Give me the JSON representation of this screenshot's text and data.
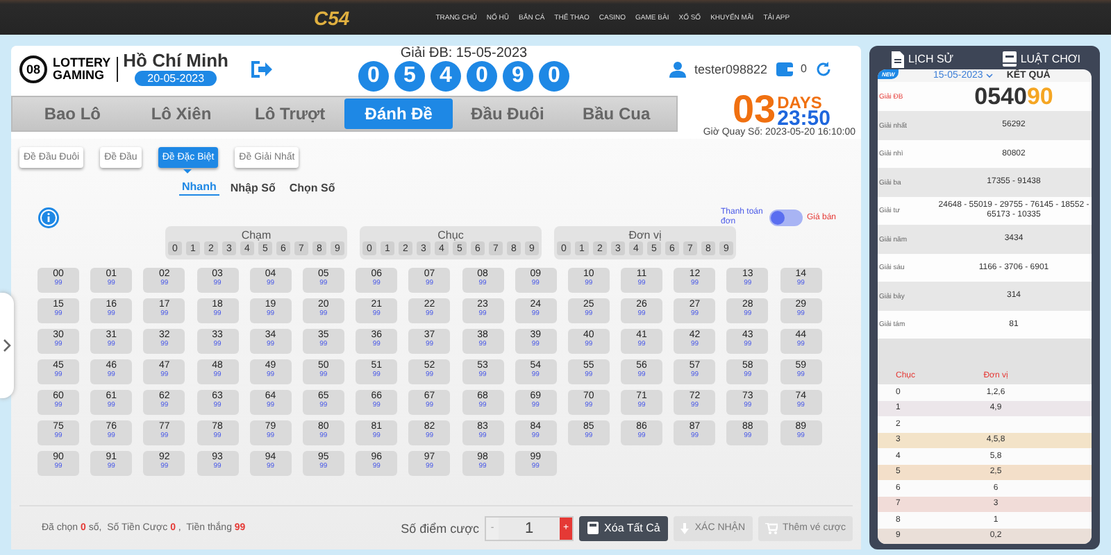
{
  "top_nav": {
    "logo": "C54",
    "items": [
      "TRANG CHỦ",
      "NỔ HŨ",
      "BẮN CÁ",
      "THỂ THAO",
      "CASINO",
      "GAME BÀI",
      "XỔ SỐ",
      "KHUYẾN MÃI",
      "TẢI APP"
    ]
  },
  "header": {
    "brand_badge": "08",
    "brand_line1": "LOTTERY",
    "brand_line2": "GAMING",
    "region": "Hồ Chí Minh",
    "date": "20-05-2023",
    "result_title": "Giải ĐB: 15-05-2023",
    "result_digits": [
      "0",
      "5",
      "4",
      "0",
      "9",
      "0"
    ],
    "username": "tester098822",
    "balance": "0"
  },
  "game_tabs": [
    {
      "label": "Bao Lô",
      "selected": false
    },
    {
      "label": "Lô Xiên",
      "selected": false
    },
    {
      "label": "Lô Trượt",
      "selected": false
    },
    {
      "label": "Đánh Đề",
      "selected": true
    },
    {
      "label": "Đầu Đuôi",
      "selected": false
    },
    {
      "label": "Bầu Cua",
      "selected": false
    }
  ],
  "countdown": {
    "days": "03",
    "days_label": "DAYS",
    "time": "23:50",
    "draw_time": "Giờ Quay Số: 2023-05-20 16:10:00"
  },
  "bet_types": [
    {
      "label": "Đề Đầu Đuôi",
      "selected": false
    },
    {
      "label": "Đề Đầu",
      "selected": false
    },
    {
      "label": "Đề Đặc Biệt",
      "selected": true
    },
    {
      "label": "Đề Giải Nhất",
      "selected": false
    }
  ],
  "modes": [
    {
      "label": "Nhanh",
      "selected": true
    },
    {
      "label": "Nhập Số",
      "selected": false
    },
    {
      "label": "Chọn Số",
      "selected": false
    }
  ],
  "toggle": {
    "left_label": "Thanh toán đơn",
    "right_label": "Giá bán",
    "on": false
  },
  "digit_groups": [
    {
      "title": "Chạm",
      "digits": [
        {
          "d": "0",
          "selected": false
        },
        {
          "d": "1",
          "selected": false
        },
        {
          "d": "2",
          "selected": false
        },
        {
          "d": "3",
          "selected": false
        },
        {
          "d": "4",
          "selected": false
        },
        {
          "d": "5",
          "selected": false
        },
        {
          "d": "6",
          "selected": false
        },
        {
          "d": "7",
          "selected": false
        },
        {
          "d": "8",
          "selected": false
        },
        {
          "d": "9",
          "selected": false
        }
      ]
    },
    {
      "title": "Chục",
      "digits": [
        {
          "d": "0",
          "selected": false
        },
        {
          "d": "1",
          "selected": false
        },
        {
          "d": "2",
          "selected": false
        },
        {
          "d": "3",
          "selected": false
        },
        {
          "d": "4",
          "selected": false
        },
        {
          "d": "5",
          "selected": false
        },
        {
          "d": "6",
          "selected": false
        },
        {
          "d": "7",
          "selected": false
        },
        {
          "d": "8",
          "selected": false
        },
        {
          "d": "9",
          "selected": false
        }
      ]
    },
    {
      "title": "Đơn vị",
      "digits": [
        {
          "d": "0",
          "selected": false
        },
        {
          "d": "1",
          "selected": false
        },
        {
          "d": "2",
          "selected": false
        },
        {
          "d": "3",
          "selected": false
        },
        {
          "d": "4",
          "selected": false
        },
        {
          "d": "5",
          "selected": false
        },
        {
          "d": "6",
          "selected": false
        },
        {
          "d": "7",
          "selected": false
        },
        {
          "d": "8",
          "selected": false
        },
        {
          "d": "9",
          "selected": false
        }
      ]
    }
  ],
  "numbers": [
    {
      "n": "00",
      "odds": "99",
      "selected": false
    },
    {
      "n": "01",
      "odds": "99",
      "selected": false
    },
    {
      "n": "02",
      "odds": "99",
      "selected": false
    },
    {
      "n": "03",
      "odds": "99",
      "selected": false
    },
    {
      "n": "04",
      "odds": "99",
      "selected": false
    },
    {
      "n": "05",
      "odds": "99",
      "selected": false
    },
    {
      "n": "06",
      "odds": "99",
      "selected": false
    },
    {
      "n": "07",
      "odds": "99",
      "selected": false
    },
    {
      "n": "08",
      "odds": "99",
      "selected": false
    },
    {
      "n": "09",
      "odds": "99",
      "selected": false
    },
    {
      "n": "10",
      "odds": "99",
      "selected": false
    },
    {
      "n": "11",
      "odds": "99",
      "selected": false
    },
    {
      "n": "12",
      "odds": "99",
      "selected": false
    },
    {
      "n": "13",
      "odds": "99",
      "selected": false
    },
    {
      "n": "14",
      "odds": "99",
      "selected": false
    },
    {
      "n": "15",
      "odds": "99",
      "selected": false
    },
    {
      "n": "16",
      "odds": "99",
      "selected": false
    },
    {
      "n": "17",
      "odds": "99",
      "selected": false
    },
    {
      "n": "18",
      "odds": "99",
      "selected": false
    },
    {
      "n": "19",
      "odds": "99",
      "selected": false
    },
    {
      "n": "20",
      "odds": "99",
      "selected": false
    },
    {
      "n": "21",
      "odds": "99",
      "selected": false
    },
    {
      "n": "22",
      "odds": "99",
      "selected": false
    },
    {
      "n": "23",
      "odds": "99",
      "selected": false
    },
    {
      "n": "24",
      "odds": "99",
      "selected": false
    },
    {
      "n": "25",
      "odds": "99",
      "selected": false
    },
    {
      "n": "26",
      "odds": "99",
      "selected": false
    },
    {
      "n": "27",
      "odds": "99",
      "selected": false
    },
    {
      "n": "28",
      "odds": "99",
      "selected": false
    },
    {
      "n": "29",
      "odds": "99",
      "selected": false
    },
    {
      "n": "30",
      "odds": "99",
      "selected": false
    },
    {
      "n": "31",
      "odds": "99",
      "selected": false
    },
    {
      "n": "32",
      "odds": "99",
      "selected": false
    },
    {
      "n": "33",
      "odds": "99",
      "selected": false
    },
    {
      "n": "34",
      "odds": "99",
      "selected": false
    },
    {
      "n": "35",
      "odds": "99",
      "selected": false
    },
    {
      "n": "36",
      "odds": "99",
      "selected": false
    },
    {
      "n": "37",
      "odds": "99",
      "selected": false
    },
    {
      "n": "38",
      "odds": "99",
      "selected": false
    },
    {
      "n": "39",
      "odds": "99",
      "selected": false
    },
    {
      "n": "40",
      "odds": "99",
      "selected": false
    },
    {
      "n": "41",
      "odds": "99",
      "selected": false
    },
    {
      "n": "42",
      "odds": "99",
      "selected": false
    },
    {
      "n": "43",
      "odds": "99",
      "selected": false
    },
    {
      "n": "44",
      "odds": "99",
      "selected": false
    },
    {
      "n": "45",
      "odds": "99",
      "selected": false
    },
    {
      "n": "46",
      "odds": "99",
      "selected": false
    },
    {
      "n": "47",
      "odds": "99",
      "selected": false
    },
    {
      "n": "48",
      "odds": "99",
      "selected": false
    },
    {
      "n": "49",
      "odds": "99",
      "selected": false
    },
    {
      "n": "50",
      "odds": "99",
      "selected": false
    },
    {
      "n": "51",
      "odds": "99",
      "selected": false
    },
    {
      "n": "52",
      "odds": "99",
      "selected": false
    },
    {
      "n": "53",
      "odds": "99",
      "selected": false
    },
    {
      "n": "54",
      "odds": "99",
      "selected": false
    },
    {
      "n": "55",
      "odds": "99",
      "selected": false
    },
    {
      "n": "56",
      "odds": "99",
      "selected": false
    },
    {
      "n": "57",
      "odds": "99",
      "selected": false
    },
    {
      "n": "58",
      "odds": "99",
      "selected": false
    },
    {
      "n": "59",
      "odds": "99",
      "selected": false
    },
    {
      "n": "60",
      "odds": "99",
      "selected": false
    },
    {
      "n": "61",
      "odds": "99",
      "selected": false
    },
    {
      "n": "62",
      "odds": "99",
      "selected": false
    },
    {
      "n": "63",
      "odds": "99",
      "selected": false
    },
    {
      "n": "64",
      "odds": "99",
      "selected": false
    },
    {
      "n": "65",
      "odds": "99",
      "selected": false
    },
    {
      "n": "66",
      "odds": "99",
      "selected": false
    },
    {
      "n": "67",
      "odds": "99",
      "selected": false
    },
    {
      "n": "68",
      "odds": "99",
      "selected": false
    },
    {
      "n": "69",
      "odds": "99",
      "selected": false
    },
    {
      "n": "70",
      "odds": "99",
      "selected": false
    },
    {
      "n": "71",
      "odds": "99",
      "selected": false
    },
    {
      "n": "72",
      "odds": "99",
      "selected": false
    },
    {
      "n": "73",
      "odds": "99",
      "selected": false
    },
    {
      "n": "74",
      "odds": "99",
      "selected": false
    },
    {
      "n": "75",
      "odds": "99",
      "selected": false
    },
    {
      "n": "76",
      "odds": "99",
      "selected": false
    },
    {
      "n": "77",
      "odds": "99",
      "selected": false
    },
    {
      "n": "78",
      "odds": "99",
      "selected": false
    },
    {
      "n": "79",
      "odds": "99",
      "selected": false
    },
    {
      "n": "80",
      "odds": "99",
      "selected": false
    },
    {
      "n": "81",
      "odds": "99",
      "selected": false
    },
    {
      "n": "82",
      "odds": "99",
      "selected": false
    },
    {
      "n": "83",
      "odds": "99",
      "selected": false
    },
    {
      "n": "84",
      "odds": "99",
      "selected": false
    },
    {
      "n": "85",
      "odds": "99",
      "selected": false
    },
    {
      "n": "86",
      "odds": "99",
      "selected": false
    },
    {
      "n": "87",
      "odds": "99",
      "selected": false
    },
    {
      "n": "88",
      "odds": "99",
      "selected": false
    },
    {
      "n": "89",
      "odds": "99",
      "selected": false
    },
    {
      "n": "90",
      "odds": "99",
      "selected": false
    },
    {
      "n": "91",
      "odds": "99",
      "selected": false
    },
    {
      "n": "92",
      "odds": "99",
      "selected": false
    },
    {
      "n": "93",
      "odds": "99",
      "selected": false
    },
    {
      "n": "94",
      "odds": "99",
      "selected": false
    },
    {
      "n": "95",
      "odds": "99",
      "selected": false
    },
    {
      "n": "96",
      "odds": "99",
      "selected": false
    },
    {
      "n": "97",
      "odds": "99",
      "selected": false
    },
    {
      "n": "98",
      "odds": "99",
      "selected": false
    },
    {
      "n": "99",
      "odds": "99",
      "selected": false
    }
  ],
  "footer": {
    "summary": "Đã chọn **0** số,  Số Tiền Cược **0** ,  Tiền thắng **99**",
    "points_label": "Số điểm cược",
    "minus": "-",
    "points": "1",
    "plus": "+",
    "clear_button": "Xóa Tất Cả",
    "confirm_button": {
      "label": "XÁC NHẬN",
      "disabled": true
    },
    "add_button": {
      "label": "Thêm vé cược",
      "disabled": true
    }
  },
  "side_tabs": [
    "LỊCH SỬ",
    "LUẬT CHƠI"
  ],
  "results": {
    "badge": "NEW",
    "date": "15-05-2023",
    "title": "KẾT QUẢ",
    "rows": [
      {
        "kind": "special",
        "label": "Giải ĐB",
        "value": "0540",
        "highlight": "90"
      },
      {
        "kind": "normal",
        "label": "Giải nhất",
        "value": "56292"
      },
      {
        "kind": "normal",
        "label": "Giải nhì",
        "value": "80802"
      },
      {
        "kind": "normal",
        "label": "Giải ba",
        "value": "17355 - 91438"
      },
      {
        "kind": "normal",
        "label": "Giải tư",
        "value": "24648 - 55019 - 29755 - 76145 - 18552 - 65173 - 10335"
      },
      {
        "kind": "normal",
        "label": "Giải năm",
        "value": "3434"
      },
      {
        "kind": "normal",
        "label": "Giải sáu",
        "value": "1166 - 3706 - 6901"
      },
      {
        "kind": "normal",
        "label": "Giải bảy",
        "value": "314"
      },
      {
        "kind": "normal",
        "label": "Giải tám",
        "value": "81"
      }
    ]
  },
  "loto_table": {
    "columns": [
      "Chục",
      "Đơn vị"
    ],
    "rows": [
      [
        "0",
        "1,2,6"
      ],
      [
        "1",
        "4,9"
      ],
      [
        "2",
        ""
      ],
      [
        "3",
        "4,5,8"
      ],
      [
        "4",
        "5,8"
      ],
      [
        "5",
        "2,5"
      ],
      [
        "6",
        "6"
      ],
      [
        "7",
        "3"
      ],
      [
        "8",
        "1"
      ],
      [
        "9",
        "0,2"
      ]
    ]
  }
}
